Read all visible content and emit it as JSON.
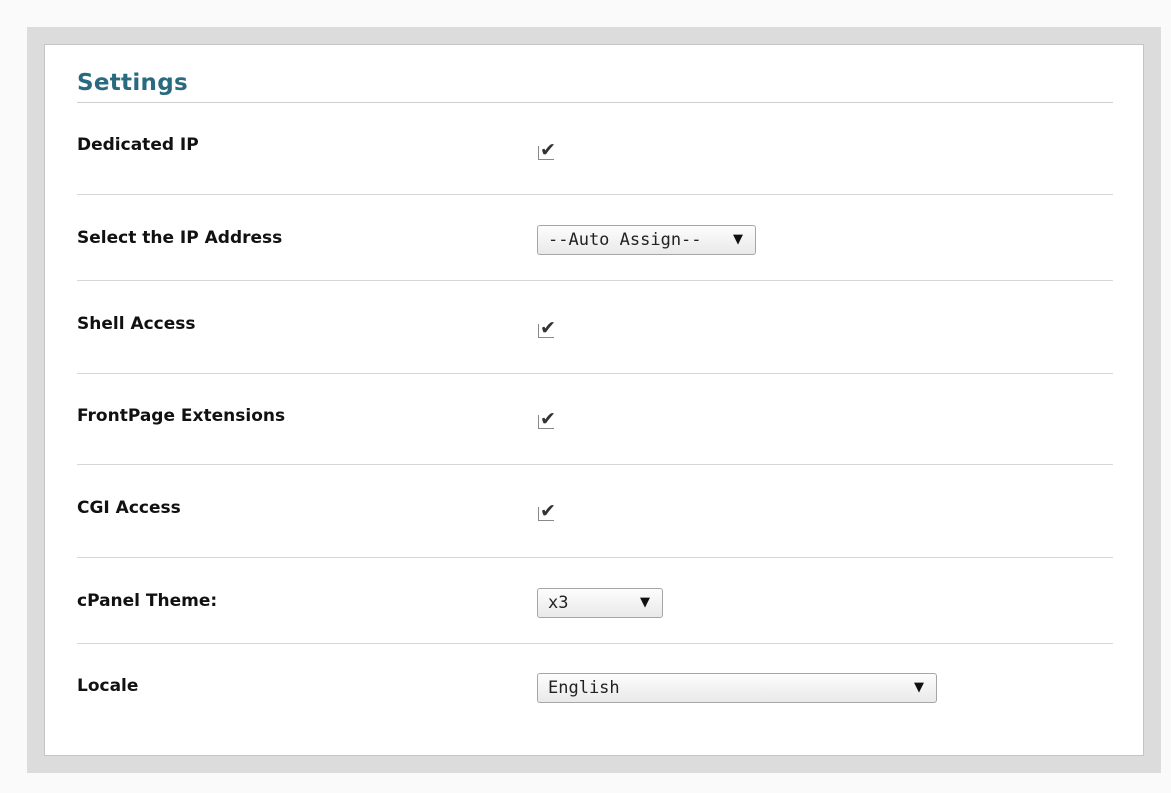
{
  "panel": {
    "title": "Settings"
  },
  "settings": {
    "dedicated_ip": {
      "label": "Dedicated IP",
      "checked": true
    },
    "ip_address": {
      "label": "Select the IP Address",
      "value": "--Auto Assign--"
    },
    "shell_access": {
      "label": "Shell Access",
      "checked": true
    },
    "frontpage": {
      "label": "FrontPage Extensions",
      "checked": true
    },
    "cgi_access": {
      "label": "CGI Access",
      "checked": true
    },
    "cpanel_theme": {
      "label": "cPanel Theme:",
      "value": "x3"
    },
    "locale": {
      "label": "Locale",
      "value": "English"
    }
  },
  "icons": {
    "check": "checkmark-icon",
    "dropdown": "caret-down-icon"
  }
}
